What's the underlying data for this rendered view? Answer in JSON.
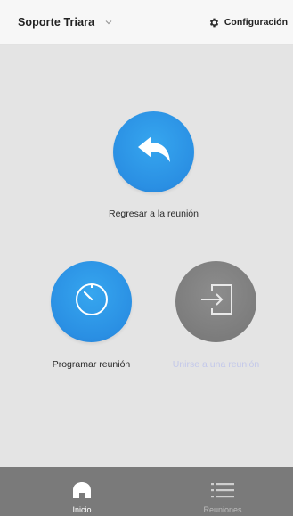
{
  "header": {
    "account_name": "Soporte Triara",
    "account_menu_icon": "chevron-down-icon",
    "settings_icon": "gear-icon",
    "settings_label": "Configuración"
  },
  "actions": {
    "back_to_meeting": {
      "icon": "reply-arrow-icon",
      "label": "Regresar a la reunión"
    },
    "schedule_meeting": {
      "icon": "clock-icon",
      "label": "Programar reunión"
    },
    "join_meeting": {
      "icon": "sign-in-icon",
      "label": "Unirse a una reunión",
      "enabled": false
    }
  },
  "tabbar": {
    "home": {
      "icon": "home-icon",
      "label": "Inicio",
      "active": true
    },
    "meetings": {
      "icon": "list-icon",
      "label": "Reuniones",
      "active": false
    }
  },
  "colors": {
    "accent_blue": "#2a8fe3",
    "disabled_gray": "#7b7b7b",
    "tabbar_bg": "#7a7a7a",
    "content_bg": "#e4e4e4",
    "header_bg": "#f7f7f7"
  }
}
